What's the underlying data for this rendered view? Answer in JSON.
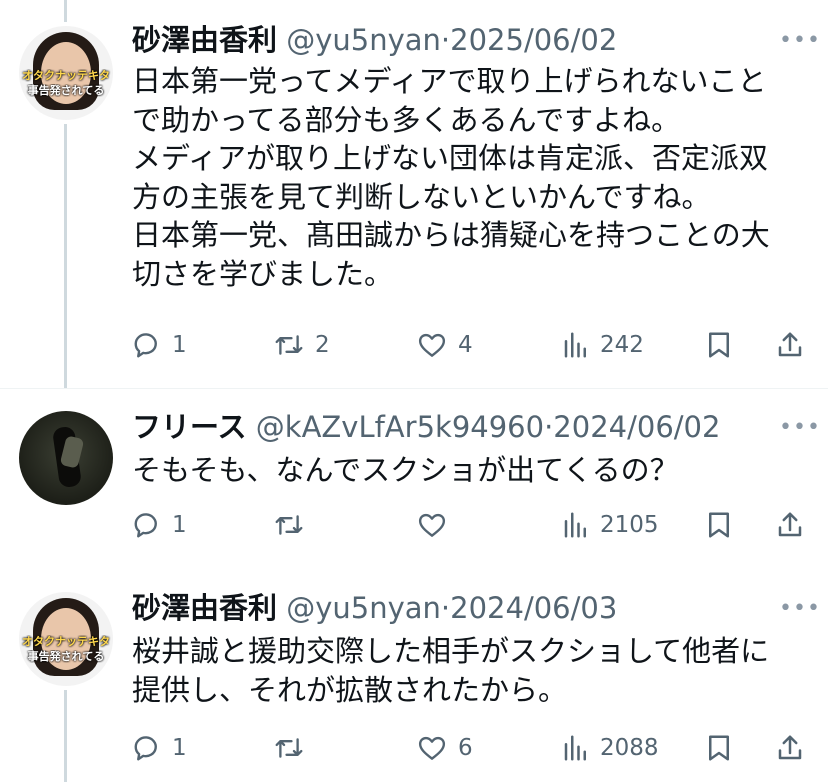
{
  "colors": {
    "text": "#0f1419",
    "secondary": "#536471",
    "icon": "#536471",
    "divider": "#eff3f4",
    "thread_line": "#cfd9de"
  },
  "tweets": [
    {
      "avatar_overlay": [
        "オタクナッテキタ",
        "事告発されてる"
      ],
      "name": "砂澤由香利",
      "handle": "@yu5nyan",
      "sep": "·",
      "date": "2025/06/02",
      "more_icon": "more-icon",
      "text": "日本第一党ってメディアで取り上げられないこと\nで助かってる部分も多くあるんですよね。\nメディアが取り上げない団体は肯定派、否定派双\n方の主張を見て判断しないといかんですね。\n日本第一党、髙田誠からは猜疑心を持つことの大\n切さを学びました。",
      "reply_count": "1",
      "retweet_count": "2",
      "like_count": "4",
      "view_count": "242"
    },
    {
      "name": "フリース",
      "handle": "@kAZvLfAr5k94960",
      "sep": "·",
      "date": "2024/06/02",
      "more_icon": "more-icon",
      "text": "そもそも、なんでスクショが出てくるの？",
      "reply_count": "1",
      "retweet_count": "",
      "like_count": "",
      "view_count": "2105"
    },
    {
      "avatar_overlay": [
        "オタクナッテキタ",
        "事告発されてる"
      ],
      "name": "砂澤由香利",
      "handle": "@yu5nyan",
      "sep": "·",
      "date": "2024/06/03",
      "more_icon": "more-icon",
      "text": "桜井誠と援助交際した相手がスクショして他者に\n提供し、それが拡散されたから。",
      "reply_count": "1",
      "retweet_count": "",
      "like_count": "6",
      "view_count": "2088"
    }
  ]
}
